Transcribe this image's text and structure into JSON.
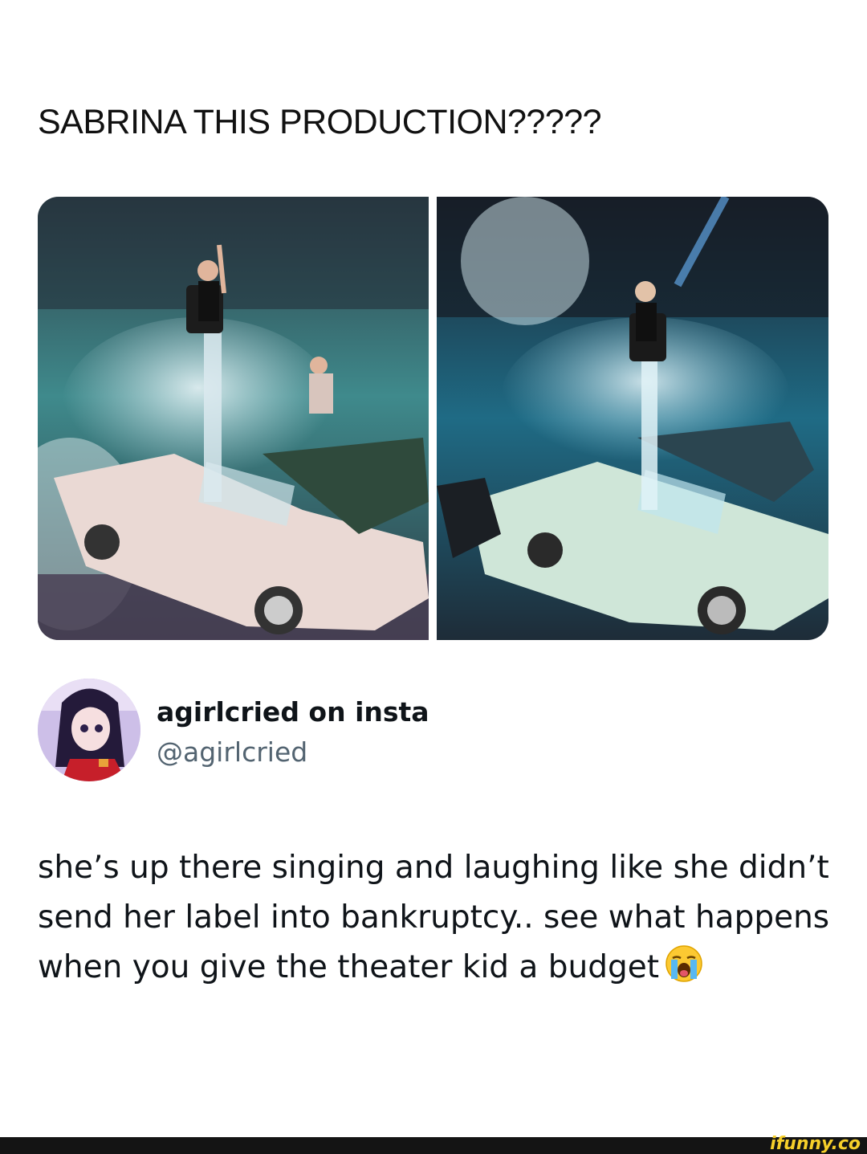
{
  "post": {
    "caption": "SABRINA THIS PRODUCTION?????"
  },
  "tweet": {
    "display_name": "agirlcried on insta",
    "handle": "@agirlcried",
    "text": "she’s up there singing and laughing like she didn’t send her label into bankruptcy.. see what happens when you give the theater kid a budget",
    "emoji": "loudly-crying-face"
  },
  "footer": {
    "watermark": "ifunny.co"
  },
  "colors": {
    "watermark": "#f6cf2a",
    "handle": "#536471",
    "text": "#0f1419",
    "footer_bg": "#141414"
  }
}
